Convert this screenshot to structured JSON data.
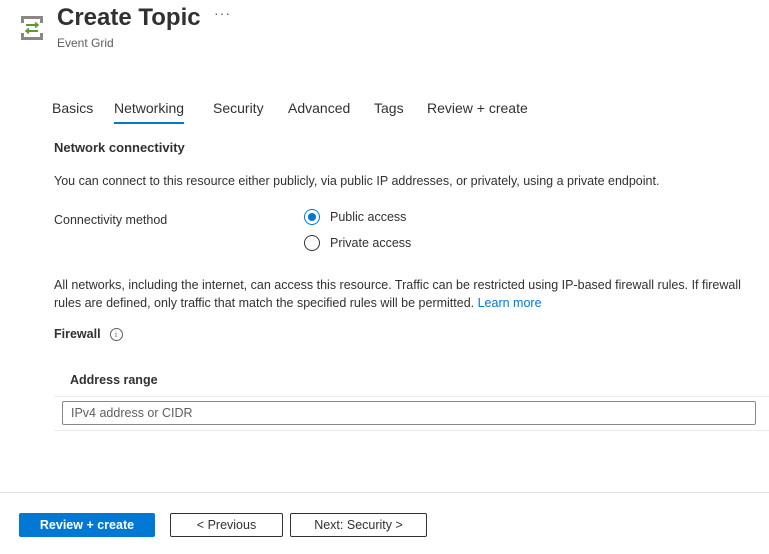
{
  "header": {
    "title": "Create Topic",
    "subtitle": "Event Grid",
    "more_label": "···",
    "icon": "event-grid-topic-icon"
  },
  "tabs": [
    {
      "label": "Basics",
      "active": false
    },
    {
      "label": "Networking",
      "active": true
    },
    {
      "label": "Security",
      "active": false
    },
    {
      "label": "Advanced",
      "active": false
    },
    {
      "label": "Tags",
      "active": false
    },
    {
      "label": "Review + create",
      "active": false
    }
  ],
  "network": {
    "heading": "Network connectivity",
    "intro": "You can connect to this resource either publicly, via public IP addresses, or privately, using a private endpoint.",
    "connectivity_label": "Connectivity method",
    "options": [
      {
        "label": "Public access",
        "checked": true
      },
      {
        "label": "Private access",
        "checked": false
      }
    ],
    "info_text": "All networks, including the internet, can access this resource. Traffic can be restricted using IP-based firewall rules. If firewall rules are defined, only traffic that match the specified rules will be permitted.",
    "learn_more": "Learn more"
  },
  "firewall": {
    "label": "Firewall",
    "column_header": "Address range",
    "placeholder": "IPv4 address or CIDR",
    "value": ""
  },
  "footer": {
    "review_create": "Review + create",
    "previous": "< Previous",
    "next": "Next: Security >"
  },
  "colors": {
    "accent": "#0078d4",
    "text": "#323130",
    "icon_green": "#5c9a38",
    "icon_gray": "#8a8886"
  }
}
